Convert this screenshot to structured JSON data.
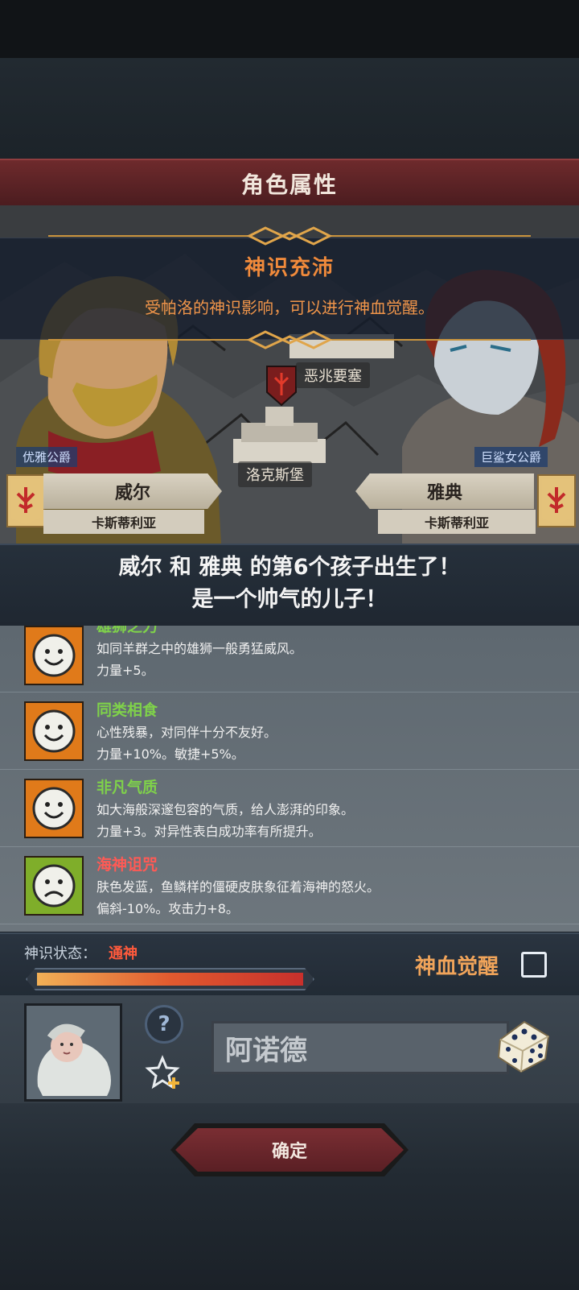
{
  "header": {
    "title": "角色属性"
  },
  "banner": {
    "title": "神识充沛",
    "subtitle": "受帕洛的神识影响，可以进行神血觉醒。"
  },
  "map": {
    "location_top": "恶兆要塞",
    "location_center": "洛克斯堡"
  },
  "father": {
    "title": "优雅公爵",
    "name": "威尔",
    "house": "卡斯蒂利亚"
  },
  "mother": {
    "title": "巨鲨女公爵",
    "name": "雅典",
    "house": "卡斯蒂利亚"
  },
  "birth": {
    "line1": "威尔 和 雅典 的第6个孩子出生了！",
    "line2": "是一个帅气的儿子！"
  },
  "traits": [
    {
      "name": "雄狮之力",
      "desc": "如同羊群之中的雄狮一般勇猛威风。",
      "effect": "力量+5。",
      "name_color": "#7fd24a",
      "icon": "smile-icon"
    },
    {
      "name": "同类相食",
      "desc": "心性残暴，对同伴十分不友好。",
      "effect": "力量+10%。敏捷+5%。",
      "name_color": "#7fd24a",
      "icon": "smile-icon"
    },
    {
      "name": "非凡气质",
      "desc": "如大海般深邃包容的气质，给人澎湃的印象。",
      "effect": "力量+3。对异性表白成功率有所提升。",
      "name_color": "#7fd24a",
      "icon": "smile-icon"
    },
    {
      "name": "海神诅咒",
      "desc": "肤色发蓝，鱼鳞样的僵硬皮肤象征着海神的怒火。",
      "effect": "偏斜-10%。攻击力+8。",
      "name_color": "#ff5a55",
      "icon": "frown-icon"
    }
  ],
  "divine": {
    "label": "神识状态：",
    "value": "通神",
    "progress": 1.0,
    "awaken_label": "神血觉醒",
    "awaken_checked": false
  },
  "child": {
    "name_value": "阿诺德"
  },
  "confirm_label": "确定"
}
